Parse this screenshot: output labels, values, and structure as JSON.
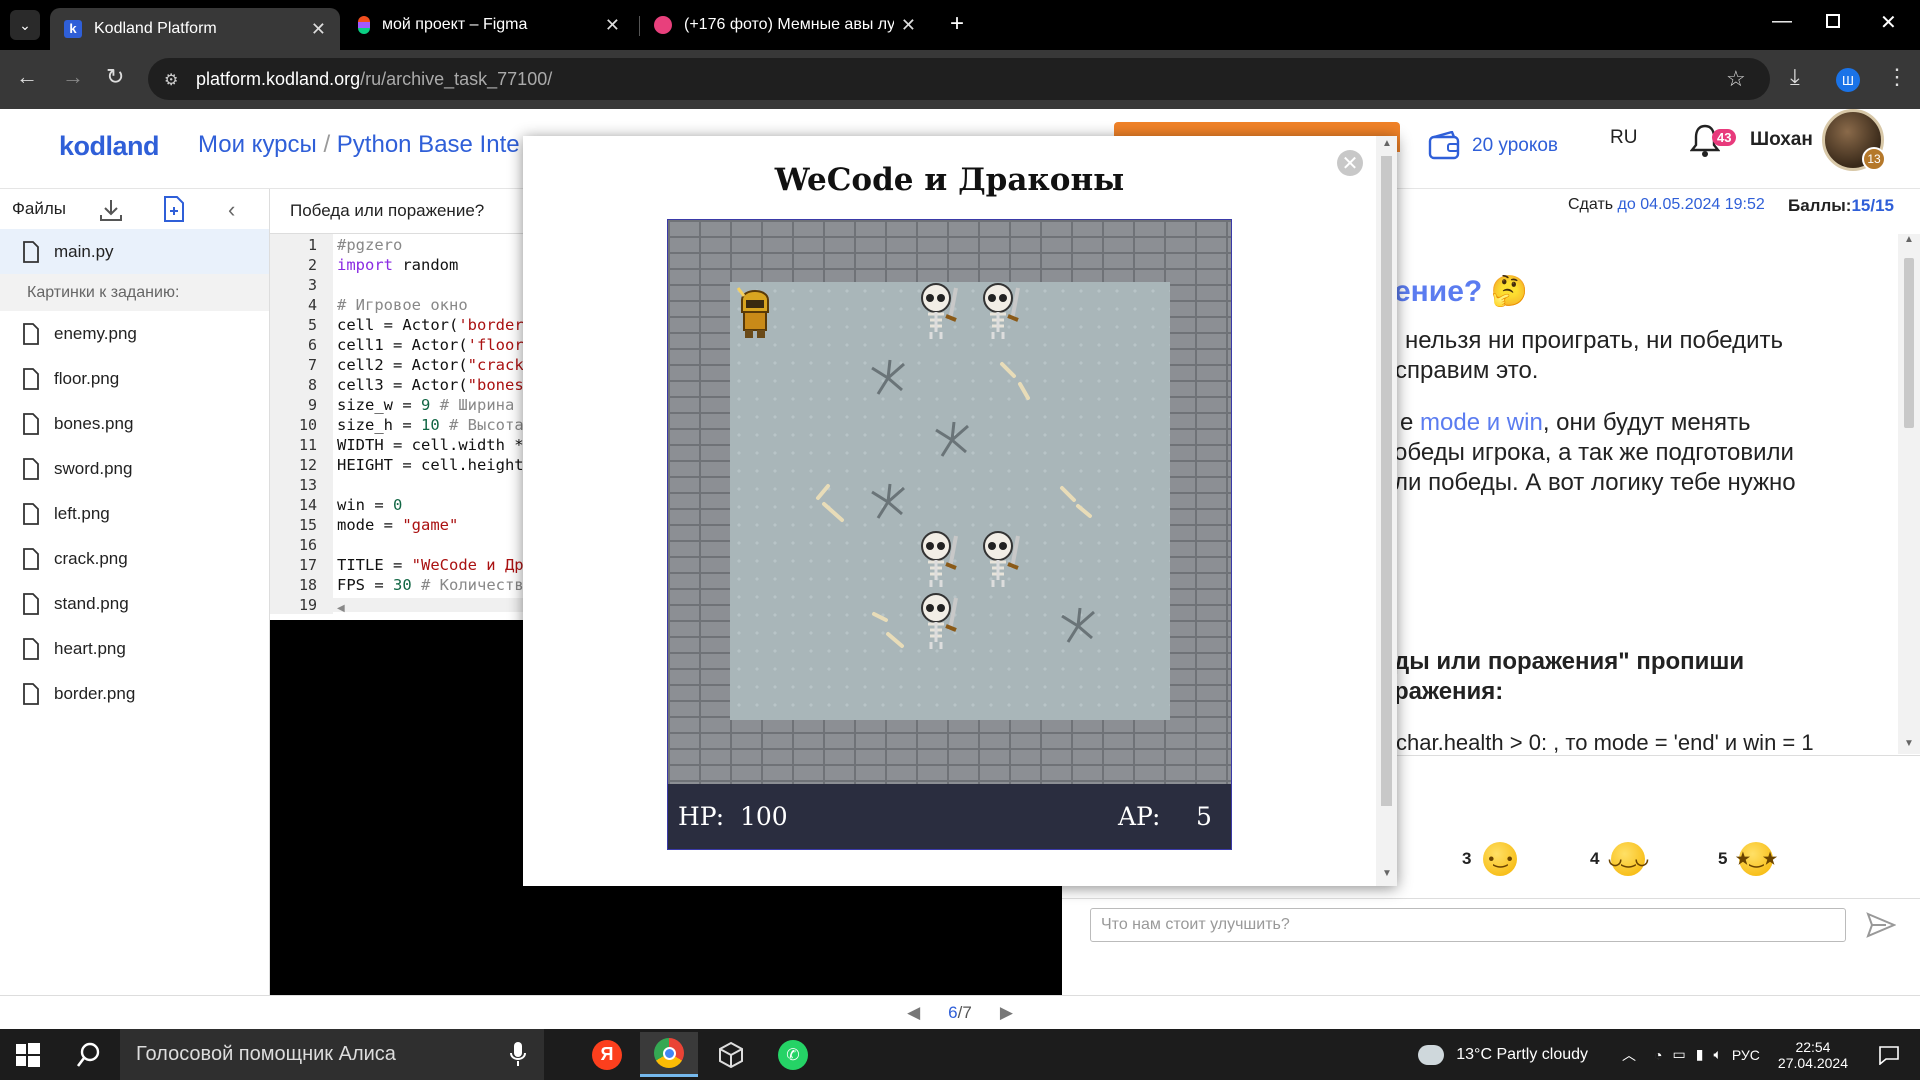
{
  "browser": {
    "tabs": [
      {
        "title": "Kodland Platform",
        "active": true
      },
      {
        "title": "мой проект – Figma",
        "active": false
      },
      {
        "title": "(+176 фото) Мемные авы лучш",
        "active": false
      }
    ],
    "url_host": "platform.kodland.org",
    "url_path": "/ru/archive_task_77100/",
    "profile_letter": "Ш"
  },
  "header": {
    "logo": "kodland",
    "crumb1": "Мои курсы",
    "crumb_sep": " / ",
    "crumb2": "Python Base Inte",
    "lessons": "20 уроков",
    "lang": "RU",
    "notifications": "43",
    "user": "Шохан",
    "level": "13"
  },
  "files": {
    "title": "Файлы",
    "main": "main.py",
    "section": "Картинки к заданию:",
    "items": [
      "enemy.png",
      "floor.png",
      "bones.png",
      "sword.png",
      "left.png",
      "crack.png",
      "stand.png",
      "heart.png",
      "border.png"
    ]
  },
  "editor": {
    "task_title": "Победа или поражение?",
    "lines": [
      "1",
      "2",
      "3",
      "4",
      "5",
      "6",
      "7",
      "8",
      "9",
      "10",
      "11",
      "12",
      "13",
      "14",
      "15",
      "16",
      "17",
      "18",
      "19"
    ]
  },
  "task": {
    "submit_prefix": "Сдать ",
    "submit_deadline": "до 04.05.2024 19:52",
    "score_label": "Баллы:",
    "score_value": "15/15",
    "heading": "ение? 🤔",
    "p1": "нельзя ни проиграть, ни победить",
    "p1b": "справим это.",
    "p2a": "е ",
    "p2_hl": "mode и win",
    "p2b": ", они будут менять",
    "p2c": "обеды игрока, а так же подготовили",
    "p2d": "ли победы. А вот логику тебе нужно",
    "p3a": "ды или поражения\" пропиши",
    "p3b": "ражения:",
    "p4": "char.health > 0: , то mode = 'end' и win = 1"
  },
  "rating": {
    "r3": "3",
    "r4": "4",
    "r5": "5"
  },
  "feedback_placeholder": "Что нам стоит улучшить?",
  "pager": {
    "current": "6",
    "sep": " / ",
    "total": "7"
  },
  "modal": {
    "title": "WeCode и Драконы",
    "hp_label": "HP:",
    "hp_value": "100",
    "ap_label": "AP:",
    "ap_value": "5"
  },
  "taskbar": {
    "search": "Голосовой помощник Алиса",
    "weather": "13°C  Partly cloudy",
    "lang": "РУС",
    "time": "22:54",
    "date": "27.04.2024"
  }
}
